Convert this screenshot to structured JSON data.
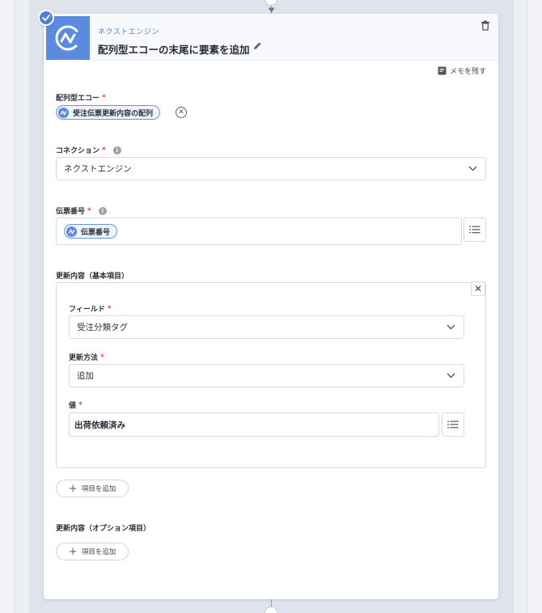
{
  "app": {
    "name": "ネクストエンジン",
    "action_title": "配列型エコーの末尾に要素を追加",
    "memo_label": "メモを残す",
    "brand_color": "#5b8be0",
    "accent_color": "#4f7fd8"
  },
  "fields": {
    "array_echo": {
      "label": "配列型エコー",
      "required_mark": "*",
      "chip_value": "受注伝票更新内容の配列"
    },
    "connection": {
      "label": "コネクション",
      "required_mark": "*",
      "selected": "ネクストエンジン"
    },
    "slip_number": {
      "label": "伝票番号",
      "required_mark": "*",
      "chip_value": "伝票番号"
    }
  },
  "basic_items": {
    "section_label": "更新内容（基本項目）",
    "field": {
      "label": "フィールド",
      "required_mark": "*",
      "selected": "受注分類タグ"
    },
    "method": {
      "label": "更新方法",
      "required_mark": "*",
      "selected": "追加"
    },
    "value": {
      "label": "値",
      "required_mark": "*",
      "text": "出荷依頼済み"
    },
    "add_label": "項目を追加"
  },
  "option_items": {
    "section_label": "更新内容（オプション項目）",
    "add_label": "項目を追加"
  },
  "icons": {
    "logo": "nextengine-logo-icon",
    "check": "check-icon",
    "edit": "pencil-icon",
    "trash": "trash-icon",
    "memo": "memo-icon",
    "info": "info-icon",
    "chevron": "chevron-down-icon",
    "list": "list-icon",
    "clear": "clear-x-icon",
    "close": "close-icon",
    "plus": "plus-icon"
  }
}
